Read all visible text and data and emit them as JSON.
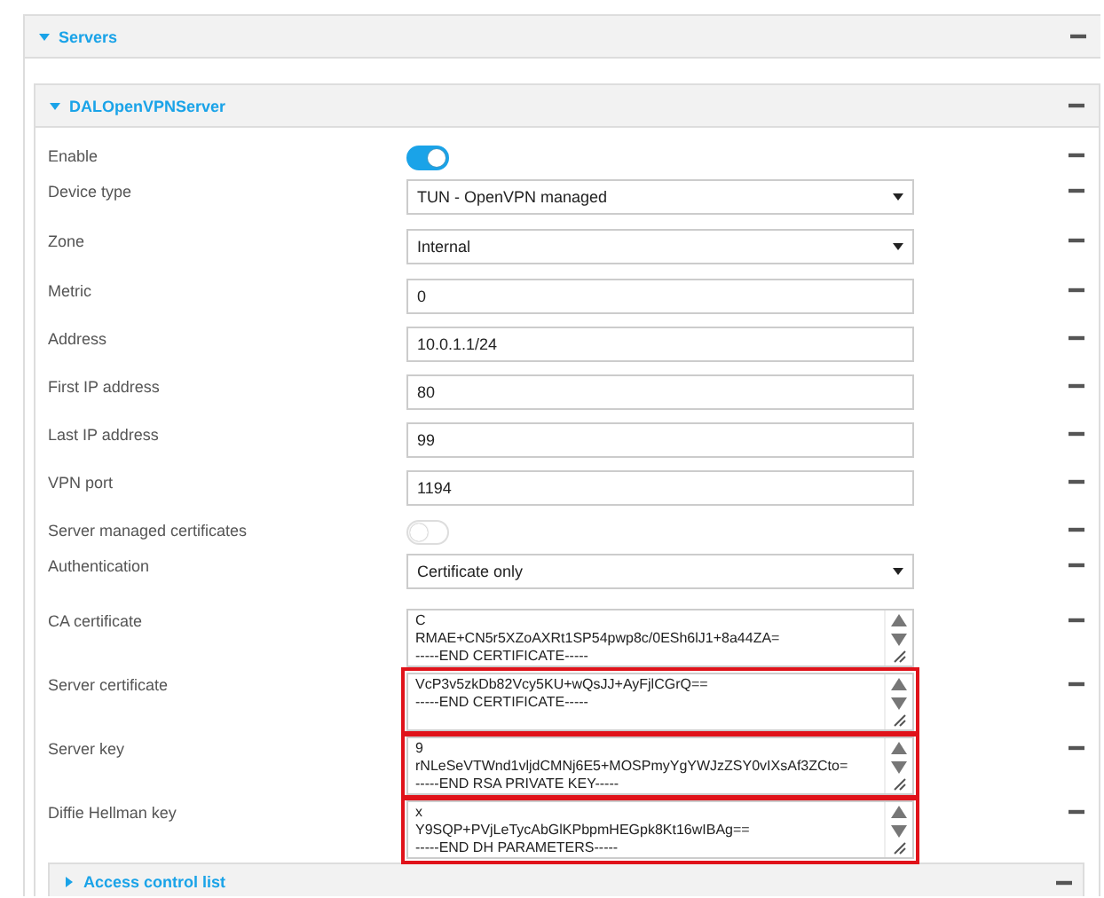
{
  "servers": {
    "title": "Servers",
    "expanded": true
  },
  "server": {
    "title": "DALOpenVPNServer",
    "expanded": true
  },
  "fields": [
    {
      "kind": "toggle",
      "label": "Enable",
      "on": true
    },
    {
      "kind": "select",
      "label": "Device type",
      "value": "TUN - OpenVPN managed"
    },
    {
      "kind": "select",
      "label": "Zone",
      "value": "Internal"
    },
    {
      "kind": "text",
      "label": "Metric",
      "value": "0"
    },
    {
      "kind": "text",
      "label": "Address",
      "value": "10.0.1.1/24"
    },
    {
      "kind": "text",
      "label": "First IP address",
      "value": "80"
    },
    {
      "kind": "text",
      "label": "Last IP address",
      "value": "99"
    },
    {
      "kind": "text",
      "label": "VPN port",
      "value": "1194"
    },
    {
      "kind": "toggle",
      "label": "Server managed certificates",
      "on": false
    },
    {
      "kind": "select",
      "label": "Authentication",
      "value": "Certificate only"
    },
    {
      "kind": "textarea",
      "label": "CA certificate",
      "lines": [
        "C",
        "RMAE+CN5r5XZoAXRt1SP54pwp8c/0ESh6lJ1+8a44ZA=",
        "-----END CERTIFICATE-----"
      ],
      "highlighted": false
    },
    {
      "kind": "textarea",
      "label": "Server certificate",
      "lines": [
        "VcP3v5zkDb82Vcy5KU+wQsJJ+AyFjlCGrQ==",
        "-----END CERTIFICATE-----"
      ],
      "highlighted": true
    },
    {
      "kind": "textarea",
      "label": "Server key",
      "lines": [
        "9",
        "rNLeSeVTWnd1vljdCMNj6E5+MOSPmyYgYWJzZSY0vIXsAf3ZCto=",
        "-----END RSA PRIVATE KEY-----"
      ],
      "highlighted": true
    },
    {
      "kind": "textarea",
      "label": "Diffie Hellman key",
      "lines": [
        "x",
        "Y9SQP+PVjLeTycAbGlKPbpmHEGpk8Kt16wIBAg==",
        "-----END DH PARAMETERS-----"
      ],
      "highlighted": true
    }
  ],
  "access_control": {
    "title": "Access control list",
    "expanded": false
  }
}
